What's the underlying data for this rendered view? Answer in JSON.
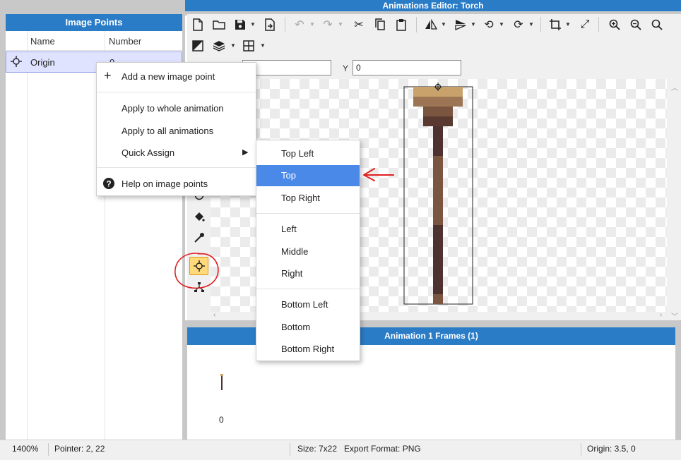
{
  "window": {
    "title": "Animations Editor: Torch"
  },
  "left_panel": {
    "header": "Image Points",
    "columns": [
      "Name",
      "Number"
    ],
    "rows": [
      {
        "name": "Origin",
        "number": "0"
      }
    ]
  },
  "toolbar": {
    "icons": [
      "new-file-icon",
      "open-folder-icon",
      "save-icon",
      "export-icon",
      "undo-icon",
      "redo-icon",
      "cut-icon",
      "copy-icon",
      "paste-icon",
      "flip-horizontal-icon",
      "flip-vertical-icon",
      "rotate-left-icon",
      "rotate-right-icon",
      "crop-icon",
      "resize-icon",
      "zoom-in-icon",
      "zoom-out-icon",
      "zoom-fit-icon",
      "color-mode-icon",
      "layers-icon",
      "grid-icon"
    ]
  },
  "coords": {
    "x_value": "",
    "y_label": "Y",
    "y_value": "0"
  },
  "context_menu": {
    "add": "Add a new image point",
    "apply_whole": "Apply to whole animation",
    "apply_all": "Apply to all animations",
    "quick_assign": "Quick Assign",
    "help": "Help on image points"
  },
  "quick_assign_menu": {
    "top_left": "Top Left",
    "top": "Top",
    "top_right": "Top Right",
    "left": "Left",
    "middle": "Middle",
    "right": "Right",
    "bottom_left": "Bottom Left",
    "bottom": "Bottom",
    "bottom_right": "Bottom Right",
    "highlighted": "Top"
  },
  "frames_panel": {
    "header": "Animation 1 Frames (1)",
    "frames": [
      {
        "number": "0"
      }
    ]
  },
  "status": {
    "zoom": "1400%",
    "pointer": "Pointer: 2, 22",
    "size": "Size: 7x22",
    "format": "Export Format: PNG",
    "origin": "Origin: 3.5, 0"
  },
  "colors": {
    "accent_blue": "#2a7cc7",
    "menu_highlight": "#4a89e8",
    "active_tool": "#ffd97a",
    "annotation_red": "#e02020",
    "torch_wood_dark": "#4e3230",
    "torch_wood_light": "#7a5640",
    "torch_head": "#c8a26a"
  }
}
